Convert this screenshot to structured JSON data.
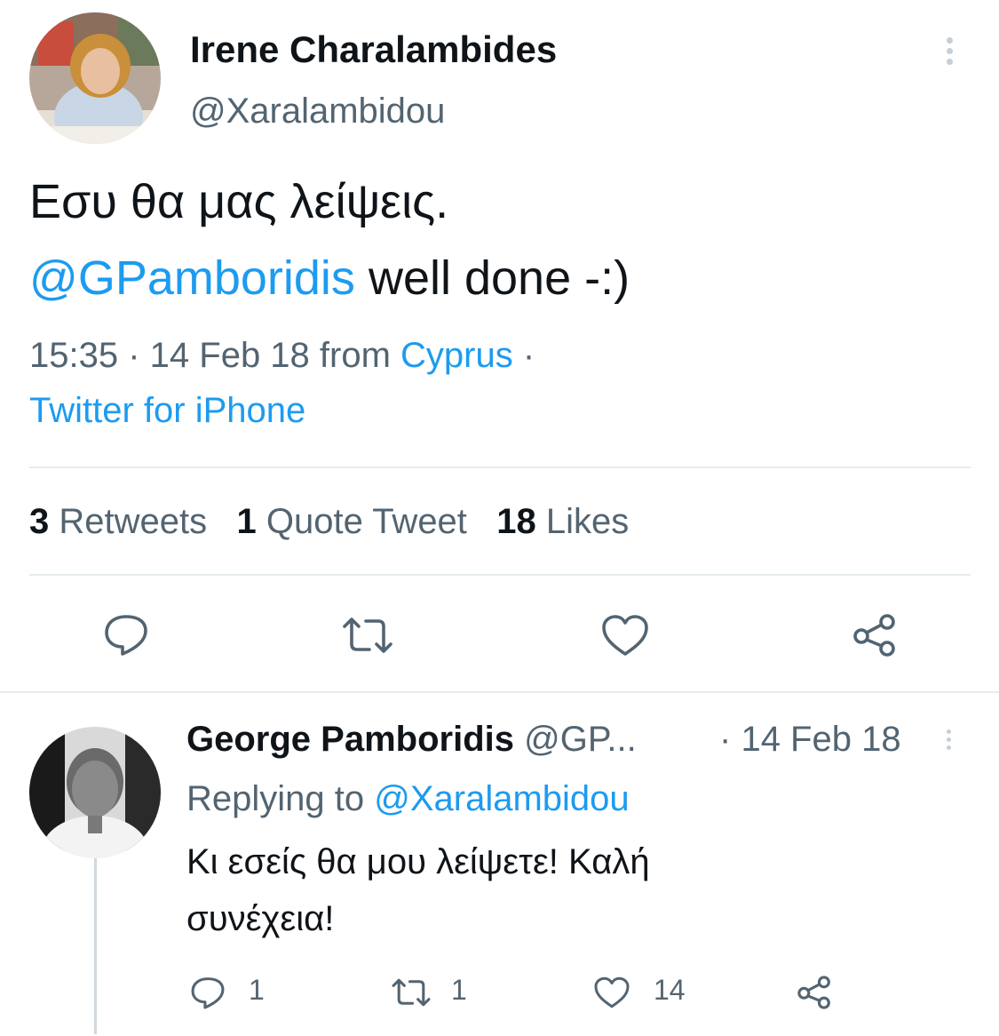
{
  "tweet": {
    "author_name": "Irene Charalambides",
    "author_handle": "@Xaralambidou",
    "text_line1": "Εσυ θα μας λείψεις.",
    "mention": "@GPamboridis",
    "text_line2_rest": " well done -:)",
    "time": "15:35",
    "sep1": " · ",
    "date": "14 Feb 18",
    "from_word": " from ",
    "location": "Cyprus",
    "sep2": " ·",
    "client": "Twitter for iPhone",
    "stats": {
      "retweets_count": "3",
      "retweets_label": "Retweets",
      "quotes_count": "1",
      "quotes_label": "Quote Tweet",
      "likes_count": "18",
      "likes_label": "Likes"
    },
    "icons": {
      "reply": "reply-icon",
      "retweet": "retweet-icon",
      "like": "heart-icon",
      "share": "share-icon",
      "more": "more-options-icon"
    }
  },
  "reply": {
    "author_name": "George Pamboridis",
    "author_handle": "@GP...",
    "date_sep": "·",
    "date": "14 Feb 18",
    "replying_label": "Replying to",
    "replying_handle": "@Xaralambidou",
    "text_line1": "Κι εσείς θα μου λείψετε! Καλή",
    "text_line2": "συνέχεια!",
    "reply_count": "1",
    "retweet_count": "1",
    "like_count": "14"
  },
  "colors": {
    "link": "#1d9bf0",
    "secondary_text": "#536471",
    "divider": "#e6ecf0"
  }
}
